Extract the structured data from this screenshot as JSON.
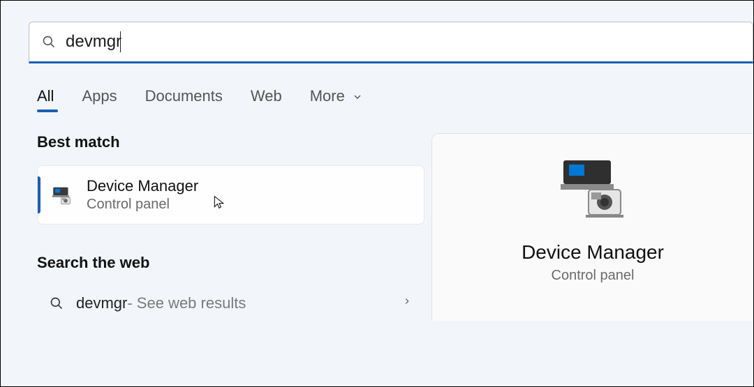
{
  "search": {
    "value": "devmgr"
  },
  "tabs": {
    "items": [
      {
        "label": "All",
        "active": true
      },
      {
        "label": "Apps",
        "active": false
      },
      {
        "label": "Documents",
        "active": false
      },
      {
        "label": "Web",
        "active": false
      },
      {
        "label": "More",
        "active": false,
        "hasDropdown": true
      }
    ]
  },
  "sections": {
    "bestMatch": {
      "header": "Best match",
      "result": {
        "title": "Device Manager",
        "subtitle": "Control panel"
      }
    },
    "searchWeb": {
      "header": "Search the web",
      "query": "devmgr",
      "hint": " - See web results"
    }
  },
  "preview": {
    "title": "Device Manager",
    "subtitle": "Control panel"
  }
}
